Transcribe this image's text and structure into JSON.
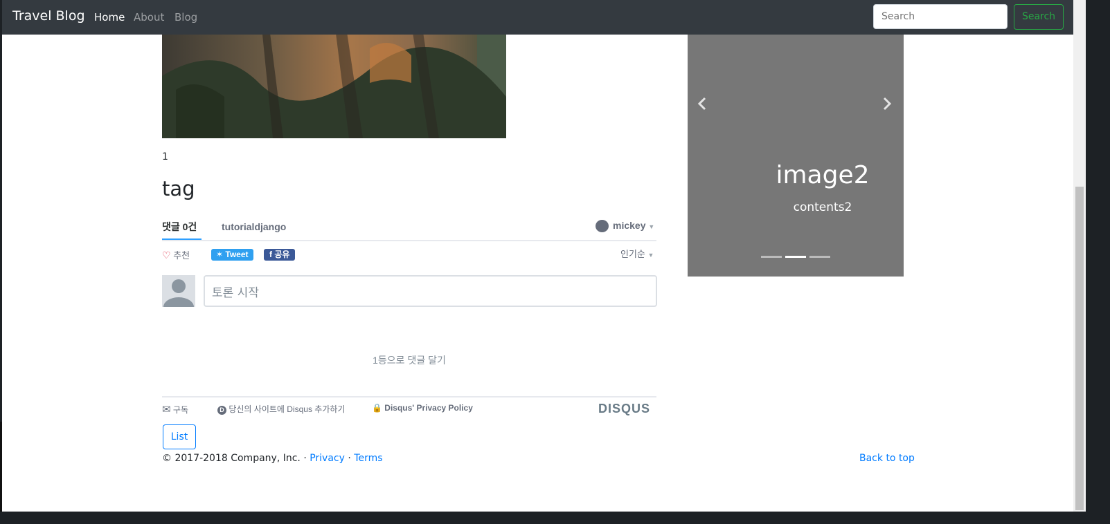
{
  "navbar": {
    "brand": "Travel Blog",
    "links": [
      "Home",
      "About",
      "Blog"
    ],
    "active": "Home",
    "search_placeholder": "Search",
    "search_button": "Search"
  },
  "post": {
    "body": "1",
    "title": "tag"
  },
  "disqus": {
    "tab_comments": "댓글 0건",
    "community": "tutorialdjango",
    "user": "mickey",
    "recommend": "추천",
    "tweet": "Tweet",
    "share": "공유",
    "sort": "인기순",
    "textbox_placeholder": "토론 시작",
    "empty": "1등으로 댓글 달기",
    "subscribe": "구독",
    "add_disqus": "당신의 사이트에 Disqus 추가하기",
    "privacy": "Disqus' Privacy Policy",
    "logo": "DISQUS"
  },
  "list_button": "List",
  "footer": {
    "copyright": "© 2017-2018 Company, Inc. · ",
    "privacy": "Privacy",
    "sep": " · ",
    "terms": "Terms",
    "back_to_top": "Back to top"
  },
  "carousel": {
    "title": "image2",
    "text": "contents2",
    "active_index": 1,
    "indicator_count": 3
  },
  "colors": {
    "navbar_bg": "#343a40",
    "success": "#28a745",
    "primary": "#007bff",
    "carousel_bg": "#777777",
    "disqus_accent": "#2e9fff"
  }
}
